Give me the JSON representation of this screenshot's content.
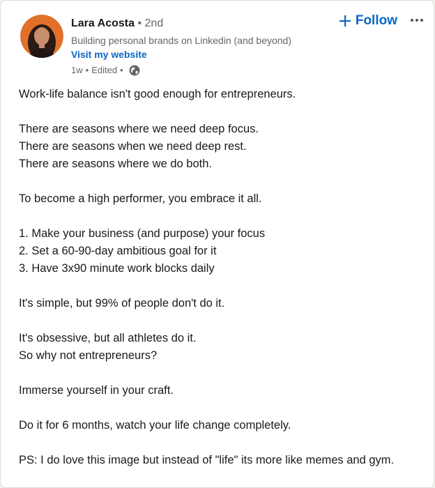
{
  "author": {
    "name": "Lara Acosta",
    "separator": "•",
    "degree": "2nd",
    "headline": "Building personal brands on Linkedin (and beyond)",
    "website_label": "Visit my website"
  },
  "post_meta": {
    "time": "1w",
    "sep1": "•",
    "edited": "Edited",
    "sep2": "•",
    "visibility_icon": "globe-icon"
  },
  "actions": {
    "follow_label": "Follow",
    "follow_icon": "plus-icon",
    "more_icon": "more-horizontal-icon"
  },
  "colors": {
    "link_blue": "#0a66c2",
    "muted_text": "#666666"
  },
  "post": {
    "lines": [
      "Work-life balance isn't good enough for entrepreneurs.",
      "",
      "There are seasons where we need deep focus.",
      "There are seasons when we need deep rest.",
      "There are seasons where we do both.",
      "",
      "To become a high performer, you embrace it all.",
      "",
      "1. Make your business (and purpose) your focus",
      "2. Set a 60-90-day ambitious goal for it",
      "3. Have 3x90 minute work blocks daily",
      "",
      "It's simple, but 99% of people don't do it.",
      "",
      "It's obsessive, but all athletes do it.",
      "So why not entrepreneurs?",
      "",
      "Immerse yourself in your craft.",
      "",
      "Do it for 6 months, watch your life change completely.",
      "",
      "PS: I do love this image but instead of \"life\" its more like memes and gym."
    ]
  }
}
